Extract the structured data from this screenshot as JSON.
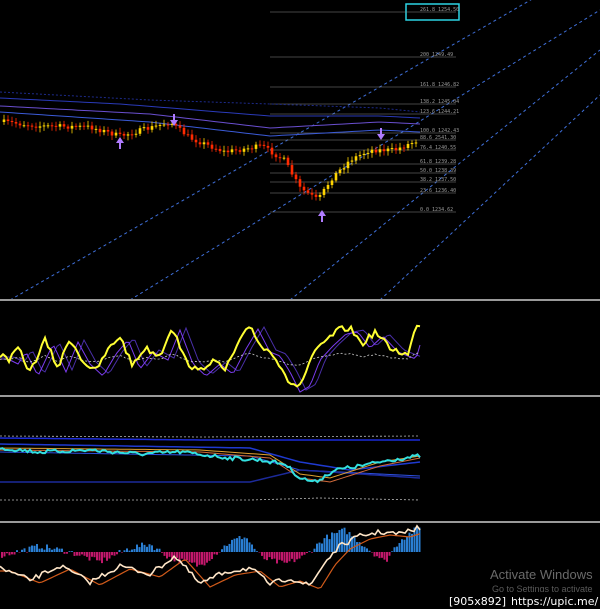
{
  "chart_data": {
    "type": "candlestick",
    "panels": [
      "price",
      "oscillator",
      "moving-averages",
      "histogram"
    ],
    "price_panel": {
      "fib_levels": [
        {
          "label": "261.8 1254.50"
        },
        {
          "label": "200 1249.49"
        },
        {
          "label": "161.8 1246.82"
        },
        {
          "label": "138.2 1245.04"
        },
        {
          "label": "123.6 1244.21"
        },
        {
          "label": "100.0 1242.43"
        },
        {
          "label": "88.6 2541.30"
        },
        {
          "label": "76.4 1240.55"
        },
        {
          "label": "61.8 1239.28"
        },
        {
          "label": "50.0 1238.39"
        },
        {
          "label": "38.2 1237.50"
        },
        {
          "label": "23.6 1236.40"
        },
        {
          "label": "0.0 1234.62"
        }
      ]
    },
    "colors": {
      "background": "#000000",
      "separator": "#9a9a9a",
      "candle_up": "#ffd400",
      "candle_down": "#ff2a00",
      "oscillator": "#ffff33",
      "fast_line": "#33e0e0",
      "histogram_up": "#2a7fd4",
      "histogram_down": "#c2186b",
      "fib_box": "#2cd4e4",
      "trend_channel": "#3f6fd8"
    }
  },
  "watermark": {
    "title": "Activate Windows",
    "subtitle": "Go to Settings to activate"
  },
  "footer": {
    "size": "[905x892]",
    "url": "https://upic.me/"
  }
}
